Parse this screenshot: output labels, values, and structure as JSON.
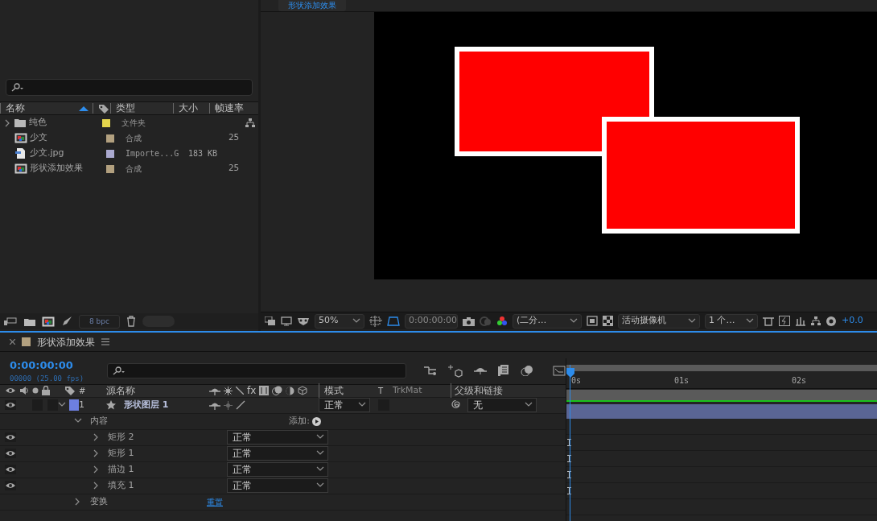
{
  "project_panel": {
    "columns": [
      {
        "kind": "name",
        "label": "名称",
        "sorted": true
      },
      {
        "kind": "label"
      },
      {
        "kind": "type",
        "label": "类型"
      },
      {
        "kind": "size",
        "label": "大小"
      },
      {
        "kind": "fps",
        "label": "帧速率"
      }
    ],
    "items": [
      {
        "kind": "folder",
        "name": "纯色",
        "color": "#e3d44c",
        "type": "文件夹"
      },
      {
        "kind": "comp",
        "name": "少文",
        "color": "#b2a07f",
        "type": "合成",
        "fps": "25"
      },
      {
        "kind": "image",
        "name": "少文.jpg",
        "color": "#aaa9cf",
        "type": "Importe...G",
        "size": "183 KB"
      },
      {
        "kind": "comp",
        "name": "形状添加效果",
        "color": "#b2a07f",
        "type": "合成",
        "fps": "25"
      }
    ],
    "bit_depth": "8 bpc"
  },
  "viewer": {
    "tab": "形状添加效果",
    "zoom": "50%",
    "timecode": "0:00:00:00",
    "resolution": "(二分…",
    "camera": "活动摄像机",
    "views": "1 个…",
    "exposure": "+0.0"
  },
  "timeline": {
    "comp_name": "形状添加效果",
    "timecode": "0:00:00:00",
    "frame_info": "00000 (25.00 fps)",
    "headers": {
      "number": "#",
      "effects": "fx",
      "source_name": "源名称",
      "mode": "模式",
      "trkmat_t": "T",
      "trkmat": "TrkMat",
      "parent": "父级和链接"
    },
    "layers": [
      {
        "number": "1",
        "name": "形状图层 1",
        "color": "#6d7fe0",
        "mode": "正常",
        "parent": "无",
        "visible": true,
        "expanded": true,
        "groups": [
          {
            "name": "内容",
            "expanded": true,
            "action": "添加:",
            "children": [
              {
                "name": "矩形 2",
                "mode": "正常",
                "visible": true
              },
              {
                "name": "矩形 1",
                "mode": "正常",
                "visible": true
              },
              {
                "name": "描边 1",
                "mode": "正常",
                "visible": true
              },
              {
                "name": "填充 1",
                "mode": "正常",
                "visible": true
              }
            ]
          },
          {
            "name": "变换",
            "expanded": false,
            "link": "重置"
          }
        ]
      }
    ],
    "ruler": [
      "0s",
      "01s",
      "02s"
    ]
  }
}
